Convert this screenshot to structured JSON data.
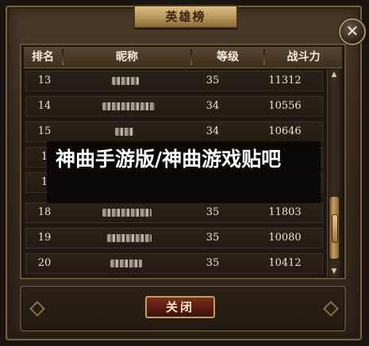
{
  "window": {
    "title": "英雄榜",
    "close_symbol": "✕"
  },
  "table": {
    "headers": {
      "rank": "排名",
      "name": "昵称",
      "level": "等级",
      "power": "战斗力"
    },
    "rows": [
      {
        "rank": "13",
        "level": "35",
        "power": "11312"
      },
      {
        "rank": "14",
        "level": "34",
        "power": "10556"
      },
      {
        "rank": "15",
        "level": "34",
        "power": "10646"
      },
      {
        "rank": "1",
        "level": "",
        "power": ""
      },
      {
        "rank": "1",
        "level": "",
        "power": ""
      },
      {
        "rank": "18",
        "level": "35",
        "power": "11803"
      },
      {
        "rank": "19",
        "level": "35",
        "power": "10080"
      },
      {
        "rank": "20",
        "level": "35",
        "power": "10412"
      }
    ]
  },
  "scrollbar": {
    "up_arrow": "▲",
    "down_arrow": "▼"
  },
  "watermark": {
    "text": "神曲手游版/神曲游戏贴吧"
  },
  "footer": {
    "close_label": "关闭"
  }
}
